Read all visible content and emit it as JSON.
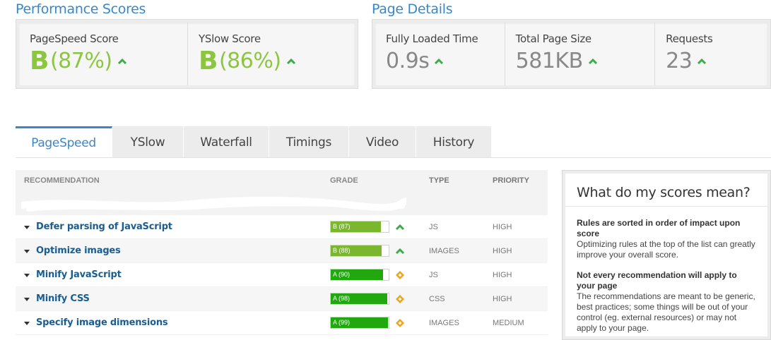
{
  "performance": {
    "title": "Performance Scores",
    "pagespeed": {
      "label": "PageSpeed Score",
      "grade": "B",
      "percent": "(87%)"
    },
    "yslow": {
      "label": "YSlow Score",
      "grade": "B",
      "percent": "(86%)"
    }
  },
  "details": {
    "title": "Page Details",
    "load_time": {
      "label": "Fully Loaded Time",
      "value": "0.9s"
    },
    "page_size": {
      "label": "Total Page Size",
      "value": "581KB"
    },
    "requests": {
      "label": "Requests",
      "value": "23"
    }
  },
  "tabs": [
    {
      "label": "PageSpeed"
    },
    {
      "label": "YSlow"
    },
    {
      "label": "Waterfall"
    },
    {
      "label": "Timings"
    },
    {
      "label": "Video"
    },
    {
      "label": "History"
    }
  ],
  "table": {
    "headers": {
      "recommendation": "RECOMMENDATION",
      "grade": "GRADE",
      "type": "TYPE",
      "priority": "PRIORITY"
    },
    "rows": [
      {
        "name": "Defer parsing of JavaScript",
        "grade": "B (87)",
        "score": 87,
        "type": "JS",
        "priority": "HIGH",
        "icon": "up-arrow-icon"
      },
      {
        "name": "Optimize images",
        "grade": "B (88)",
        "score": 88,
        "type": "IMAGES",
        "priority": "HIGH",
        "icon": "up-arrow-icon"
      },
      {
        "name": "Minify JavaScript",
        "grade": "A (90)",
        "score": 90,
        "type": "JS",
        "priority": "HIGH",
        "icon": "diamond-icon"
      },
      {
        "name": "Minify CSS",
        "grade": "A (98)",
        "score": 98,
        "type": "CSS",
        "priority": "HIGH",
        "icon": "diamond-icon"
      },
      {
        "name": "Specify image dimensions",
        "grade": "A (99)",
        "score": 99,
        "type": "IMAGES",
        "priority": "MEDIUM",
        "icon": "diamond-icon"
      }
    ]
  },
  "sidebar": {
    "title": "What do my scores mean?",
    "sections": [
      {
        "heading": "Rules are sorted in order of impact upon score",
        "text": "Optimizing rules at the top of the list can greatly improve your overall score."
      },
      {
        "heading": "Not every recommendation will apply to your page",
        "text": "The recommendations are meant to be generic, best practices; some things will be out of your control (eg. external resources) or may not apply to your page."
      }
    ]
  },
  "colors": {
    "accent": "#3a87c8",
    "grade_b": "#7ab72e",
    "grade_a": "#22a80f",
    "up_arrow": "#3bae4a",
    "diamond": "#f0a31c"
  }
}
